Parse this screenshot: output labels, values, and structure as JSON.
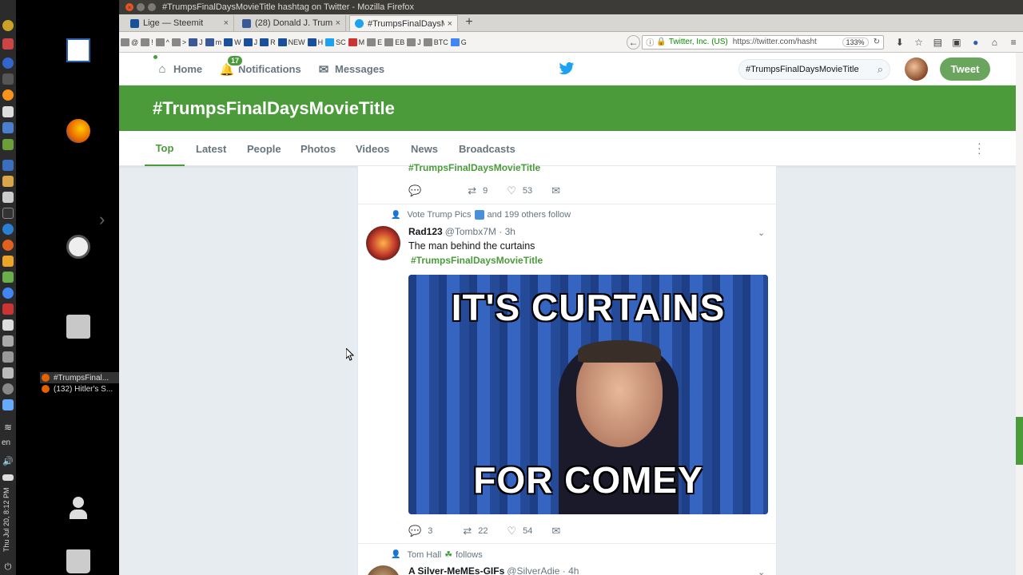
{
  "system": {
    "lang": "en",
    "clock": "Thu Jul 20, 8:12 PM"
  },
  "desktop": {
    "task_windows": [
      "#TrumpsFinal...",
      "(132) Hitler's S..."
    ]
  },
  "firefox": {
    "title": "#TrumpsFinalDaysMovieTitle hashtag on Twitter - Mozilla Firefox",
    "tabs": [
      {
        "label": "Lige — Steemit",
        "icon_color": "#1a5099"
      },
      {
        "label": "(28) Donald J. Trump -",
        "icon_color": "#3b5998"
      },
      {
        "label": "#TrumpsFinalDaysMo",
        "icon_color": "#1da1f2"
      }
    ],
    "new_tab": "+",
    "bookmarks": [
      "@",
      "!",
      "^",
      ">",
      "J",
      "m",
      "W",
      "J",
      "R",
      "NEW",
      "H",
      "SC",
      "M",
      "E",
      "EB",
      "J",
      "BTC",
      "G"
    ],
    "url": {
      "org": "Twitter, Inc. (US)",
      "text": "https://twitter.com/hasht",
      "zoom": "133%"
    }
  },
  "twitter": {
    "nav": {
      "home": "Home",
      "notifications": "Notifications",
      "notif_count": "17",
      "messages": "Messages"
    },
    "search": {
      "value": "#TrumpsFinalDaysMovieTitle"
    },
    "tweet_button": "Tweet",
    "header_title": "#TrumpsFinalDaysMovieTitle",
    "tabs": [
      "Top",
      "Latest",
      "People",
      "Photos",
      "Videos",
      "News",
      "Broadcasts"
    ],
    "accent": "#4b9b3b",
    "tweets": [
      {
        "partial_hashtag": "#TrumpsFinalDaysMovieTitle",
        "retweets": "9",
        "likes": "53"
      },
      {
        "context": "Vote Trump Pics",
        "context_rest": "and 199 others follow",
        "name": "Rad123",
        "handle": "@Tombx7M · 3h",
        "text": "The man behind the curtains",
        "hashtag": "#TrumpsFinalDaysMovieTitle",
        "meme_top": "IT'S CURTAINS",
        "meme_bottom": "FOR COMEY",
        "replies": "3",
        "retweets": "22",
        "likes": "54"
      },
      {
        "context": "Tom Hall",
        "context_rest": "follows",
        "name": "A Silver-MeMEs-GIFs",
        "handle": "@SilverAdie · 4h"
      }
    ]
  }
}
